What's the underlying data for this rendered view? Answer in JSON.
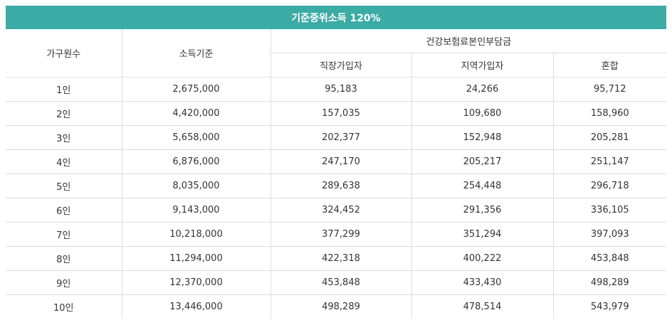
{
  "title": "기준중위소득 120%",
  "headers": {
    "household": "가구원수",
    "income": "소득기준",
    "premium_group": "건강보험료본인부담금",
    "workplace": "직장가입자",
    "regional": "지역가입자",
    "mixed": "혼합"
  },
  "rows": [
    {
      "household": "1인",
      "income": "2,675,000",
      "workplace": "95,183",
      "regional": "24,266",
      "mixed": "95,712"
    },
    {
      "household": "2인",
      "income": "4,420,000",
      "workplace": "157,035",
      "regional": "109,680",
      "mixed": "158,960"
    },
    {
      "household": "3인",
      "income": "5,658,000",
      "workplace": "202,377",
      "regional": "152,948",
      "mixed": "205,281"
    },
    {
      "household": "4인",
      "income": "6,876,000",
      "workplace": "247,170",
      "regional": "205,217",
      "mixed": "251,147"
    },
    {
      "household": "5인",
      "income": "8,035,000",
      "workplace": "289,638",
      "regional": "254,448",
      "mixed": "296,718"
    },
    {
      "household": "6인",
      "income": "9,143,000",
      "workplace": "324,452",
      "regional": "291,356",
      "mixed": "336,105"
    },
    {
      "household": "7인",
      "income": "10,218,000",
      "workplace": "377,299",
      "regional": "351,294",
      "mixed": "397,093"
    },
    {
      "household": "8인",
      "income": "11,294,000",
      "workplace": "422,318",
      "regional": "400,222",
      "mixed": "453,848"
    },
    {
      "household": "9인",
      "income": "12,370,000",
      "workplace": "453,848",
      "regional": "433,430",
      "mixed": "498,289"
    },
    {
      "household": "10인",
      "income": "13,446,000",
      "workplace": "498,289",
      "regional": "478,514",
      "mixed": "543,979"
    }
  ]
}
